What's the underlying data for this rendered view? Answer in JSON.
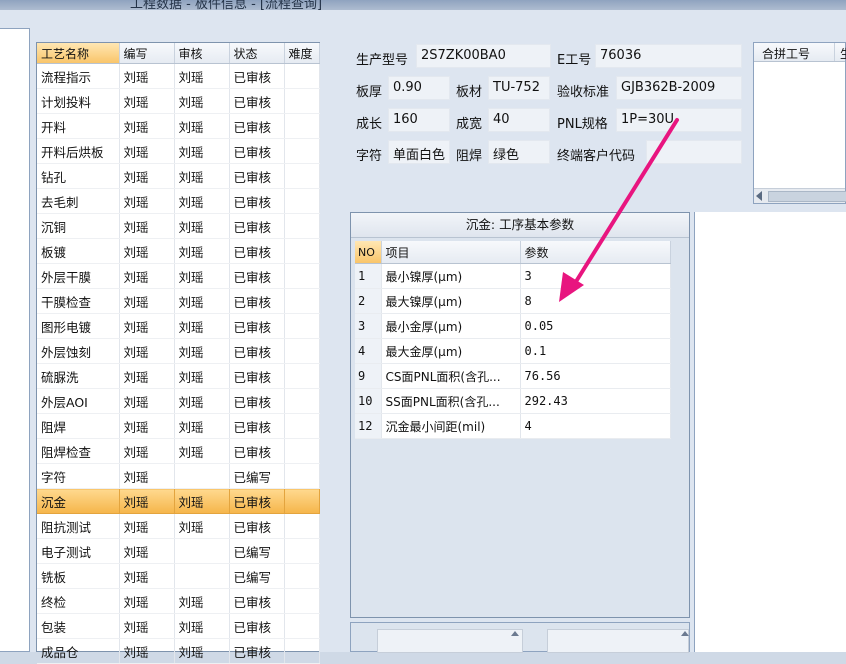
{
  "window": {
    "title_fragment": "工程数据 - 板件信息 - [流程查询]"
  },
  "process_grid": {
    "columns": [
      "工艺名称",
      "编写",
      "审核",
      "状态",
      "难度"
    ],
    "rows": [
      [
        "流程指示",
        "刘瑶",
        "刘瑶",
        "已审核",
        ""
      ],
      [
        "计划投料",
        "刘瑶",
        "刘瑶",
        "已审核",
        ""
      ],
      [
        "开料",
        "刘瑶",
        "刘瑶",
        "已审核",
        ""
      ],
      [
        "开料后烘板",
        "刘瑶",
        "刘瑶",
        "已审核",
        ""
      ],
      [
        "钻孔",
        "刘瑶",
        "刘瑶",
        "已审核",
        ""
      ],
      [
        "去毛刺",
        "刘瑶",
        "刘瑶",
        "已审核",
        ""
      ],
      [
        "沉铜",
        "刘瑶",
        "刘瑶",
        "已审核",
        ""
      ],
      [
        "板镀",
        "刘瑶",
        "刘瑶",
        "已审核",
        ""
      ],
      [
        "外层干膜",
        "刘瑶",
        "刘瑶",
        "已审核",
        ""
      ],
      [
        "干膜检查",
        "刘瑶",
        "刘瑶",
        "已审核",
        ""
      ],
      [
        "图形电镀",
        "刘瑶",
        "刘瑶",
        "已审核",
        ""
      ],
      [
        "外层蚀刻",
        "刘瑶",
        "刘瑶",
        "已审核",
        ""
      ],
      [
        "硫脲洗",
        "刘瑶",
        "刘瑶",
        "已审核",
        ""
      ],
      [
        "外层AOI",
        "刘瑶",
        "刘瑶",
        "已审核",
        ""
      ],
      [
        "阻焊",
        "刘瑶",
        "刘瑶",
        "已审核",
        ""
      ],
      [
        "阻焊检查",
        "刘瑶",
        "刘瑶",
        "已审核",
        ""
      ],
      [
        "字符",
        "刘瑶",
        "",
        "已编写",
        ""
      ],
      [
        "沉金",
        "刘瑶",
        "刘瑶",
        "已审核",
        ""
      ],
      [
        "阻抗测试",
        "刘瑶",
        "刘瑶",
        "已审核",
        ""
      ],
      [
        "电子测试",
        "刘瑶",
        "",
        "已编写",
        ""
      ],
      [
        "铣板",
        "刘瑶",
        "",
        "已编写",
        ""
      ],
      [
        "终检",
        "刘瑶",
        "刘瑶",
        "已审核",
        ""
      ],
      [
        "包装",
        "刘瑶",
        "刘瑶",
        "已审核",
        ""
      ],
      [
        "成品仓",
        "刘瑶",
        "刘瑶",
        "已审核",
        ""
      ]
    ],
    "selected_index": 17
  },
  "info": {
    "model_label": "生产型号",
    "model_value": "2S7ZK00BA0",
    "eno_label": "E工号",
    "eno_value": "76036",
    "thickness_label": "板厚",
    "thickness_value": "0.90",
    "material_label": "板材",
    "material_value": "TU-752",
    "standard_label": "验收标准",
    "standard_value": "GJB362B-2009",
    "length_label": "成长",
    "length_value": "160",
    "width_label": "成宽",
    "width_value": "40",
    "pnl_label": "PNL规格",
    "pnl_value": "1P=30U",
    "legend_label": "字符",
    "legend_value": "单面白色",
    "mask_label": "阻焊",
    "mask_value": "绿色",
    "customer_label": "终端客户代码",
    "customer_value": ""
  },
  "merge": {
    "header": "合拼工号",
    "header2": "生"
  },
  "params": {
    "caption": "沉金: 工序基本参数",
    "columns": [
      "NO",
      "项目",
      "参数"
    ],
    "rows": [
      [
        "1",
        "最小镍厚(μm)",
        "3"
      ],
      [
        "2",
        "最大镍厚(μm)",
        "8"
      ],
      [
        "3",
        "最小金厚(μm)",
        "0.05"
      ],
      [
        "4",
        "最大金厚(μm)",
        "0.1"
      ],
      [
        "9",
        "CS面PNL面积(含孔...",
        "76.56"
      ],
      [
        "10",
        "SS面PNL面积(含孔...",
        "292.43"
      ],
      [
        "12",
        "沉金最小间距(mil)",
        "4"
      ]
    ]
  },
  "annotation": {
    "arrow_color": "#e8157f"
  }
}
